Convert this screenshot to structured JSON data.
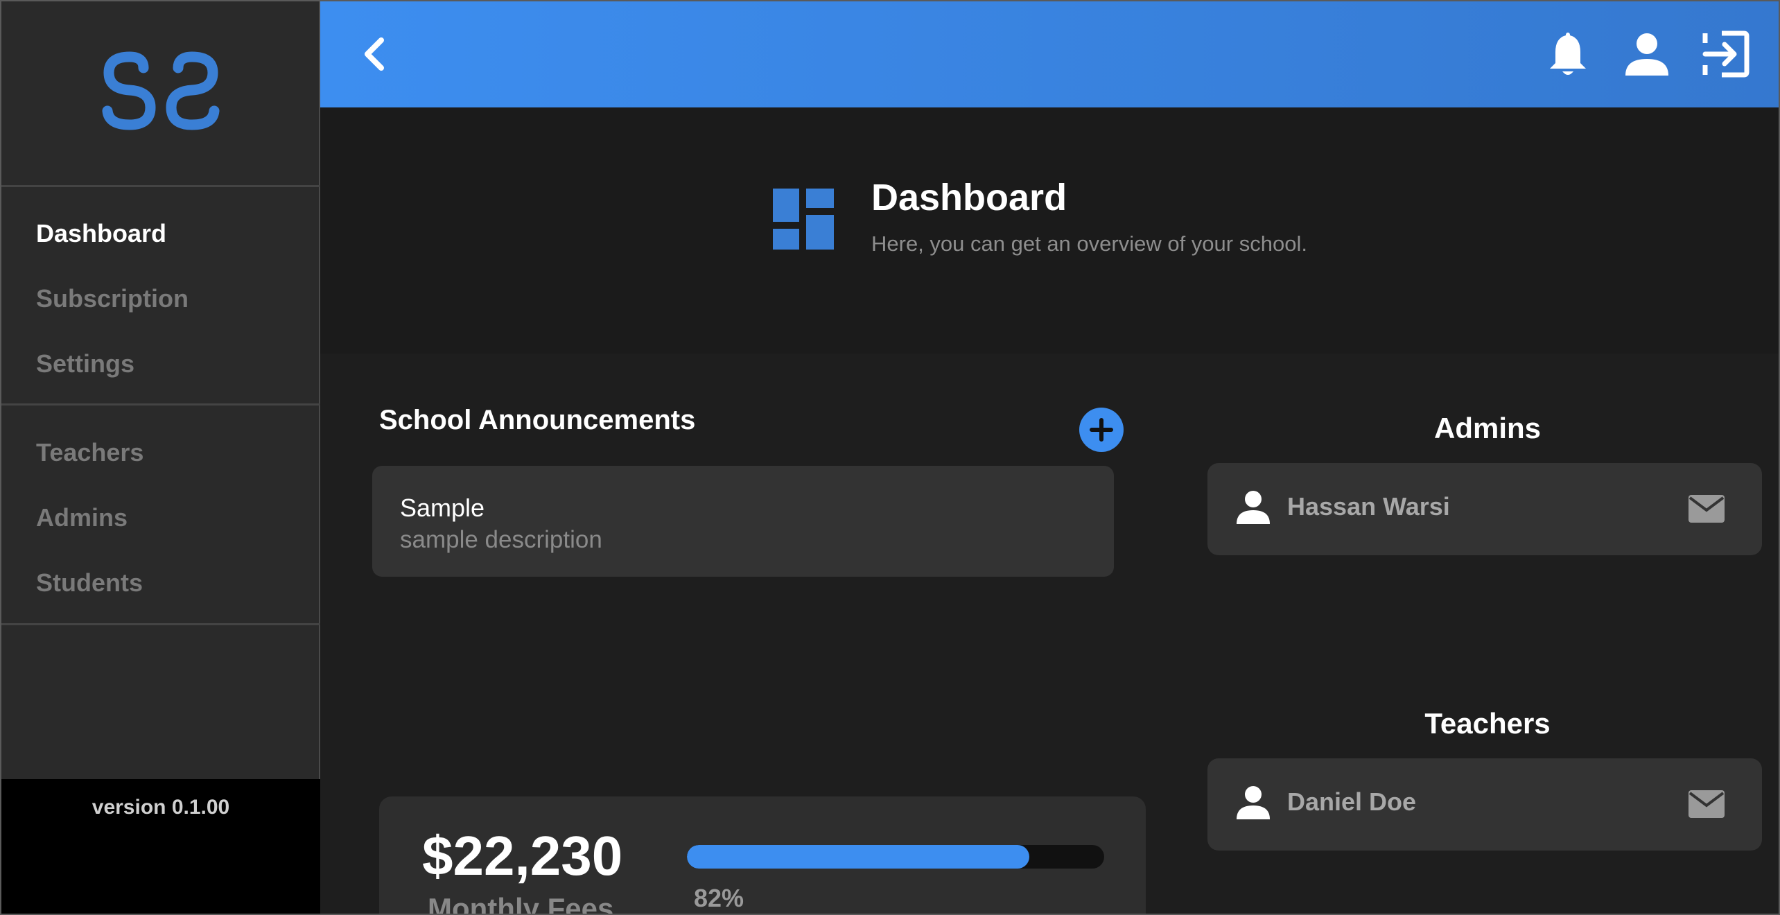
{
  "app": {
    "version": "version 0.1.00",
    "accent": "#3d8ef0"
  },
  "sidebar": {
    "items": [
      {
        "label": "Dashboard",
        "active": true
      },
      {
        "label": "Subscription"
      },
      {
        "label": "Settings"
      },
      {
        "label": "Teachers"
      },
      {
        "label": "Admins"
      },
      {
        "label": "Students"
      }
    ]
  },
  "header": {
    "icons": [
      "back-chevron-icon",
      "bell-icon",
      "user-icon",
      "logout-icon"
    ]
  },
  "page": {
    "title": "Dashboard",
    "subtitle": "Here, you can get an overview of your school.",
    "icon": "dashboard-icon"
  },
  "announcements": {
    "title": "School Announcements",
    "items": [
      {
        "title": "Sample",
        "description": "sample description"
      }
    ]
  },
  "admins": {
    "title": "Admins",
    "items": [
      {
        "name": "Hassan Warsi"
      }
    ]
  },
  "teachers": {
    "title": "Teachers",
    "items": [
      {
        "name": "Daniel Doe"
      }
    ]
  },
  "fees": {
    "amount": "$22,230",
    "label": "Monthly Fees",
    "progress_percent": 82,
    "progress_text": "82%"
  }
}
